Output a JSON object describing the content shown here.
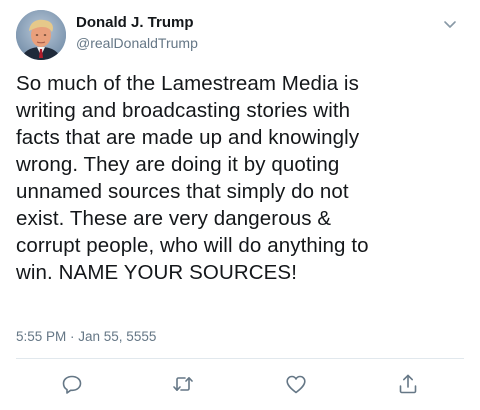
{
  "tweet": {
    "author": {
      "display_name": "Donald J. Trump",
      "handle": "@realDonaldTrump",
      "avatar_icon": "avatar-photo"
    },
    "text": "So much of the Lamestream Media is\nwriting and broadcasting stories with\nfacts that are made up and knowingly\nwrong. They are doing it by quoting\nunnamed sources that simply do not\nexist. These are very dangerous &\ncorrupt people, who will do anything to\nwin. NAME YOUR SOURCES!",
    "timestamp": "5:55 PM · Jan 55, 5555"
  },
  "icons": {
    "menu": "chevron-down-icon",
    "reply": "reply-icon",
    "retweet": "retweet-icon",
    "like": "like-icon",
    "share": "share-icon"
  },
  "colors": {
    "text_primary": "#14171a",
    "text_secondary": "#657786",
    "icon_gray": "#657786",
    "divider": "#e1e8ed"
  }
}
